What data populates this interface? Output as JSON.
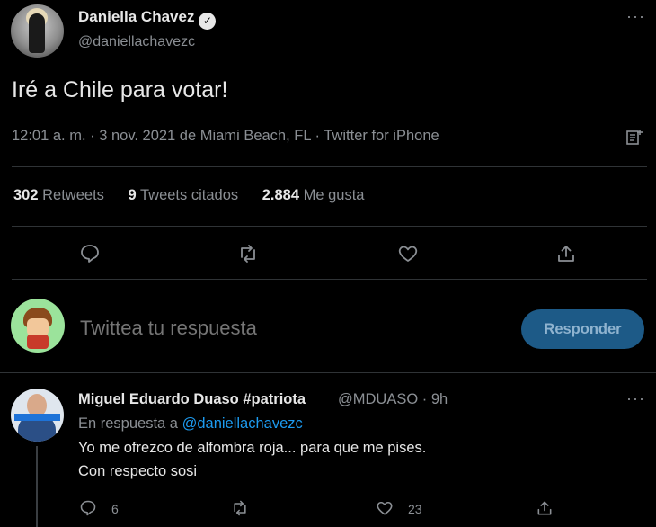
{
  "tweet": {
    "author_name": "Daniella Chavez",
    "author_handle": "@daniellachavezc",
    "text": "Iré a Chile para votar!",
    "meta": "12:01 a. m. · 3 nov. 2021 de Miami Beach, FL · Twitter for iPhone",
    "more": "···",
    "stats": {
      "retweets_count": "302",
      "retweets_label": "Retweets",
      "quotes_count": "9",
      "quotes_label": "Tweets citados",
      "likes_count": "2.884",
      "likes_label": "Me gusta"
    }
  },
  "composer": {
    "placeholder": "Twittea tu respuesta",
    "button_label": "Responder"
  },
  "reply": {
    "author_name": "Miguel Eduardo Duaso #patriota",
    "author_handle_time": "@MDUASO · 9h",
    "in_reply_prefix": "En respuesta a",
    "in_reply_mention": "@daniellachavezc",
    "line1": "Yo me ofrezco de alfombra roja... para que me pises.",
    "line2": "Con respecto sosi",
    "reply_count": "6",
    "like_count": "23",
    "more": "···"
  },
  "colors": {
    "background": "#000000",
    "accent": "#1d9bf0",
    "button": "#1d5a87",
    "secondary_text": "#8b8f94"
  }
}
